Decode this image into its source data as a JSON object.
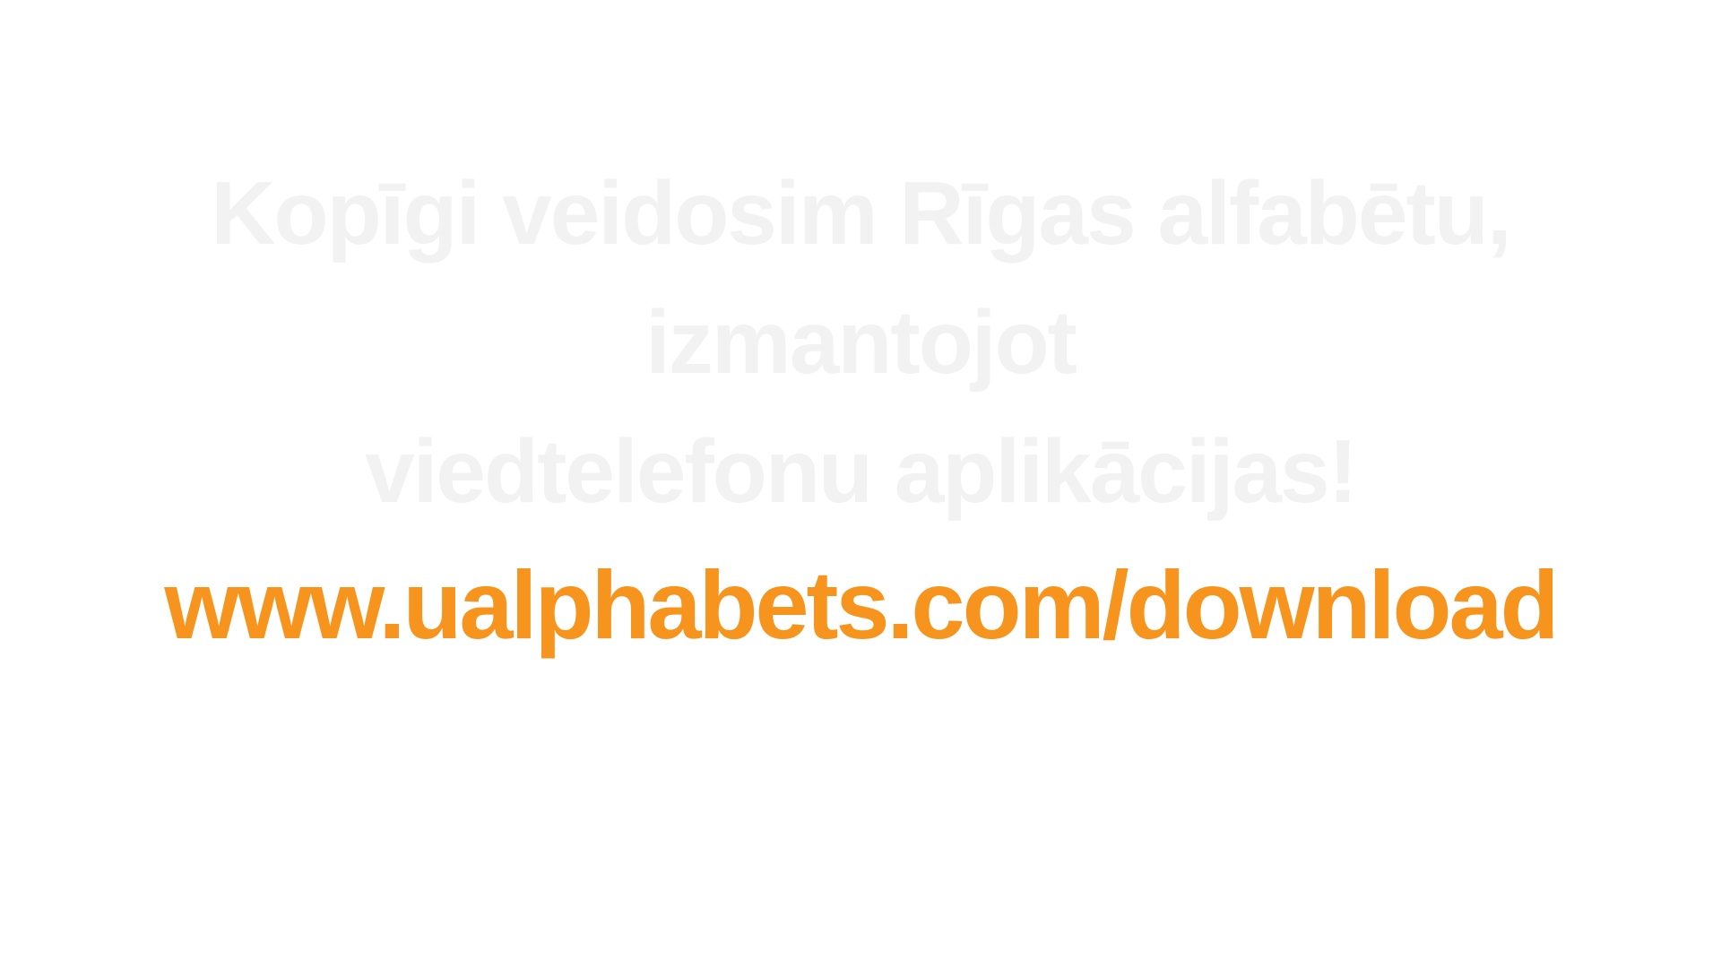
{
  "message": {
    "line1": "Kopīgi veidosim Rīgas alfabētu,",
    "line2": "izmantojot",
    "line3": "viedtelefonu aplikācijas!"
  },
  "link": {
    "url": "www.ualphabets.com/download",
    "color": "#f7941d"
  },
  "colors": {
    "heading": "#f2f2f2",
    "background": "#ffffff"
  }
}
